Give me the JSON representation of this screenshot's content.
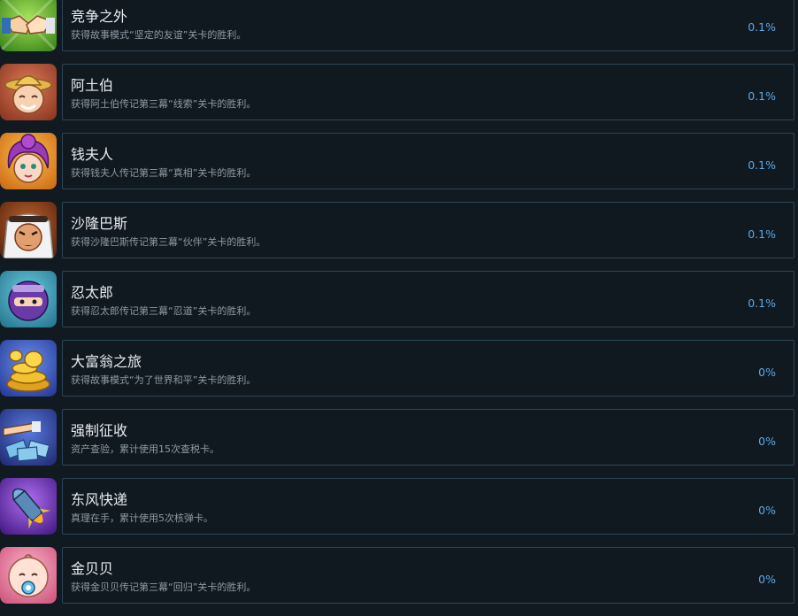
{
  "achievements": [
    {
      "title": "竞争之外",
      "description": "获得故事模式“坚定的友谊”关卡的胜利。",
      "percent": "0.1%",
      "icon": "handshake-icon",
      "bg": "#5aa22e"
    },
    {
      "title": "阿土伯",
      "description": "获得阿土伯传记第三幕“线索”关卡的胜利。",
      "percent": "0.1%",
      "icon": "old-farmer-icon",
      "bg": "#b4553b"
    },
    {
      "title": "钱夫人",
      "description": "获得钱夫人传记第三幕“真相”关卡的胜利。",
      "percent": "0.1%",
      "icon": "madame-qian-icon",
      "bg": "#e0861c"
    },
    {
      "title": "沙隆巴斯",
      "description": "获得沙隆巴斯传记第三幕“伙伴”关卡的胜利。",
      "percent": "0.1%",
      "icon": "sheikh-icon",
      "bg": "#8c3f1c"
    },
    {
      "title": "忍太郎",
      "description": "获得忍太郎传记第三幕“忍道”关卡的胜利。",
      "percent": "0.1%",
      "icon": "ninja-icon",
      "bg": "#3a9fb8"
    },
    {
      "title": "大富翁之旅",
      "description": "获得故事模式“为了世界和平”关卡的胜利。",
      "percent": "0%",
      "icon": "gold-coins-icon",
      "bg": "#3a5fc4"
    },
    {
      "title": "强制征收",
      "description": "资产查验，累计使用15次查税卡。",
      "percent": "0%",
      "icon": "tax-card-icon",
      "bg": "#3451b0"
    },
    {
      "title": "东风快递",
      "description": "真理在手，累计使用5次核弹卡。",
      "percent": "0%",
      "icon": "missile-icon",
      "bg": "#6a38b8"
    },
    {
      "title": "金贝贝",
      "description": "获得金贝贝传记第三幕“回归”关卡的胜利。",
      "percent": "0%",
      "icon": "baby-icon",
      "bg": "#e47a9a"
    }
  ]
}
